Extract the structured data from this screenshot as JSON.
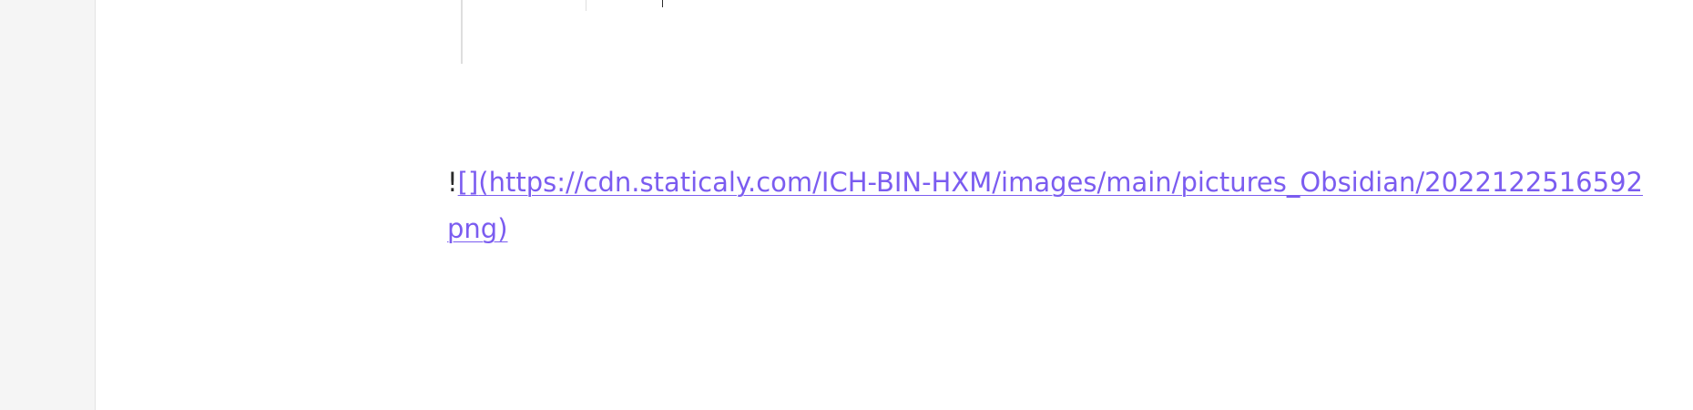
{
  "editor": {
    "line": {
      "prefix": "!",
      "brackets": "[]",
      "url_line1": "(https://cdn.staticaly.com/ICH-BIN-HXM/images/main/pictures_Obsidian/2022122516592",
      "url_line2": "png)"
    }
  },
  "colors": {
    "link": "#7b5cf0",
    "gutter_bg": "#f5f5f5",
    "text": "#2b2b2b"
  }
}
